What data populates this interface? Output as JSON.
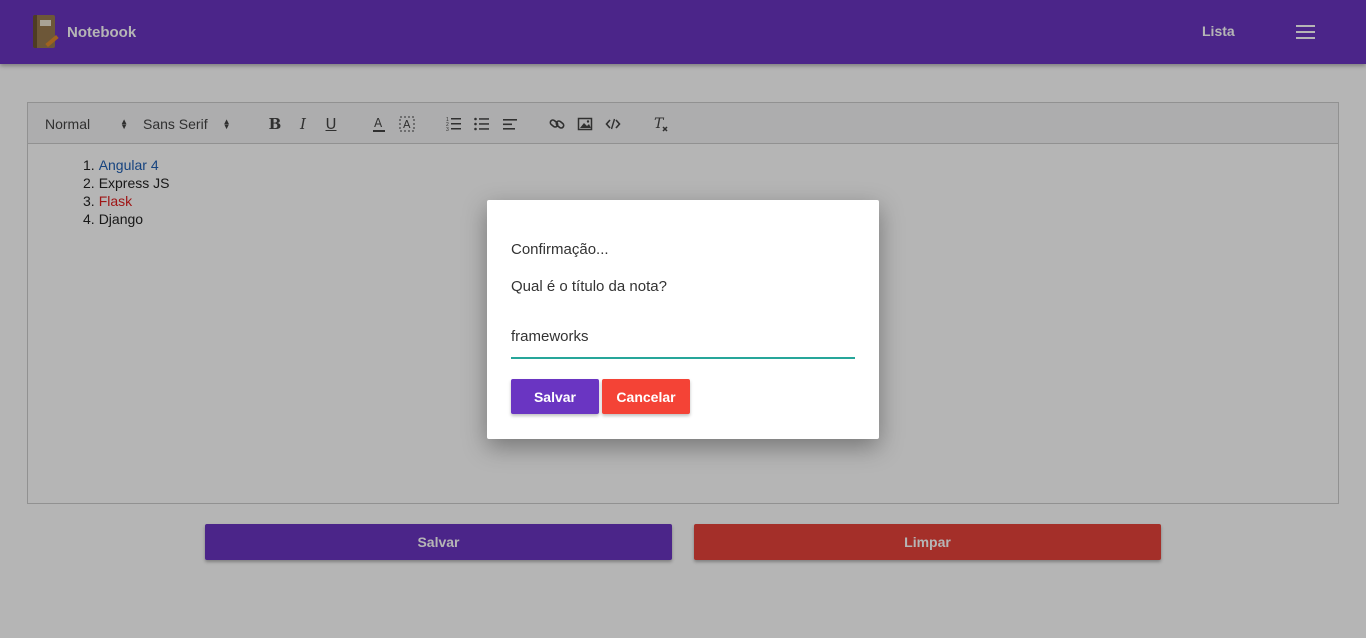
{
  "header": {
    "brand": "Notebook",
    "nav_link": "Lista",
    "colors": {
      "primary": "#6a35c2"
    }
  },
  "toolbar": {
    "header_select": "Normal",
    "font_select": "Sans Serif",
    "bold": "B",
    "italic": "I",
    "underline": "U",
    "icons": [
      "text-color-icon",
      "background-color-icon",
      "ordered-list-icon",
      "bullet-list-icon",
      "align-icon",
      "link-icon",
      "image-icon",
      "code-block-icon",
      "clear-format-icon"
    ]
  },
  "content": {
    "items": [
      {
        "num": "1.",
        "text": "Angular 4",
        "color": "#1f5fb3"
      },
      {
        "num": "2.",
        "text": "Express JS",
        "color": "#222222"
      },
      {
        "num": "3.",
        "text": "Flask",
        "color": "#e02020"
      },
      {
        "num": "4.",
        "text": "Django",
        "color": "#222222"
      }
    ]
  },
  "actions": {
    "save_label": "Salvar",
    "clear_label": "Limpar",
    "colors": {
      "save": "#6a35c2",
      "clear": "#e8433a"
    }
  },
  "modal": {
    "title": "Confirmação...",
    "question": "Qual é o título da nota?",
    "input_value": "frameworks",
    "save_label": "Salvar",
    "cancel_label": "Cancelar"
  }
}
